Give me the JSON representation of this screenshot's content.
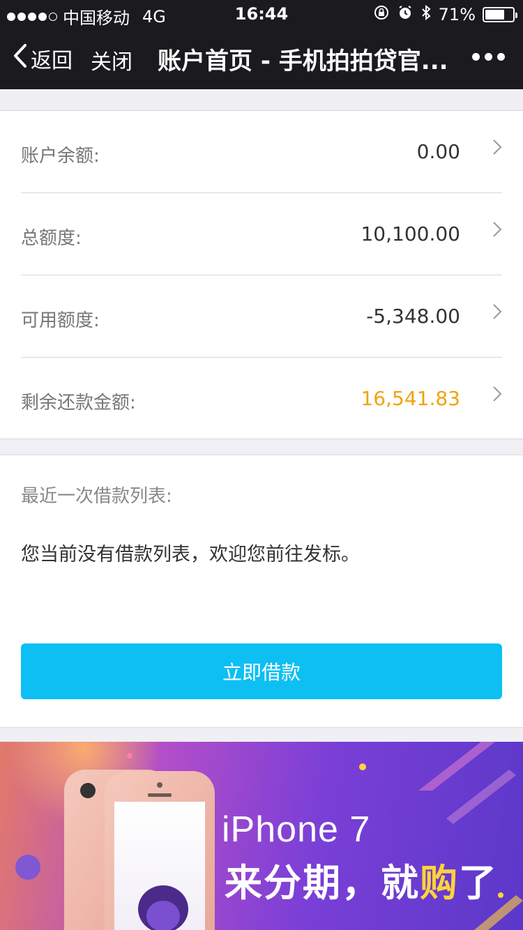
{
  "status_bar": {
    "carrier": "中国移动",
    "network": "4G",
    "time": "16:44",
    "battery": "71%",
    "battery_level": 0.71
  },
  "nav": {
    "back_label": "返回",
    "close_label": "关闭",
    "title": "账户首页 - 手机拍拍贷官...",
    "more_icon": "more-dots-icon"
  },
  "account": {
    "rows": [
      {
        "label": "账户余额:",
        "value": "0.00"
      },
      {
        "label": "总额度:",
        "value": "10,100.00"
      },
      {
        "label": "可用额度:",
        "value": "-5,348.00"
      },
      {
        "label": "剩余还款金额:",
        "value": "16,541.83"
      }
    ],
    "accent_color": "#f0a30a"
  },
  "recent": {
    "title": "最近一次借款列表:",
    "empty_message": "您当前没有借款列表，欢迎您前往发标。",
    "button_label": "立即借款",
    "button_color": "#0ebff3"
  },
  "banner": {
    "line1": "iPhone 7",
    "line2_prefix": "来分期，就",
    "line2_highlight": "购",
    "line2_suffix": "了"
  }
}
